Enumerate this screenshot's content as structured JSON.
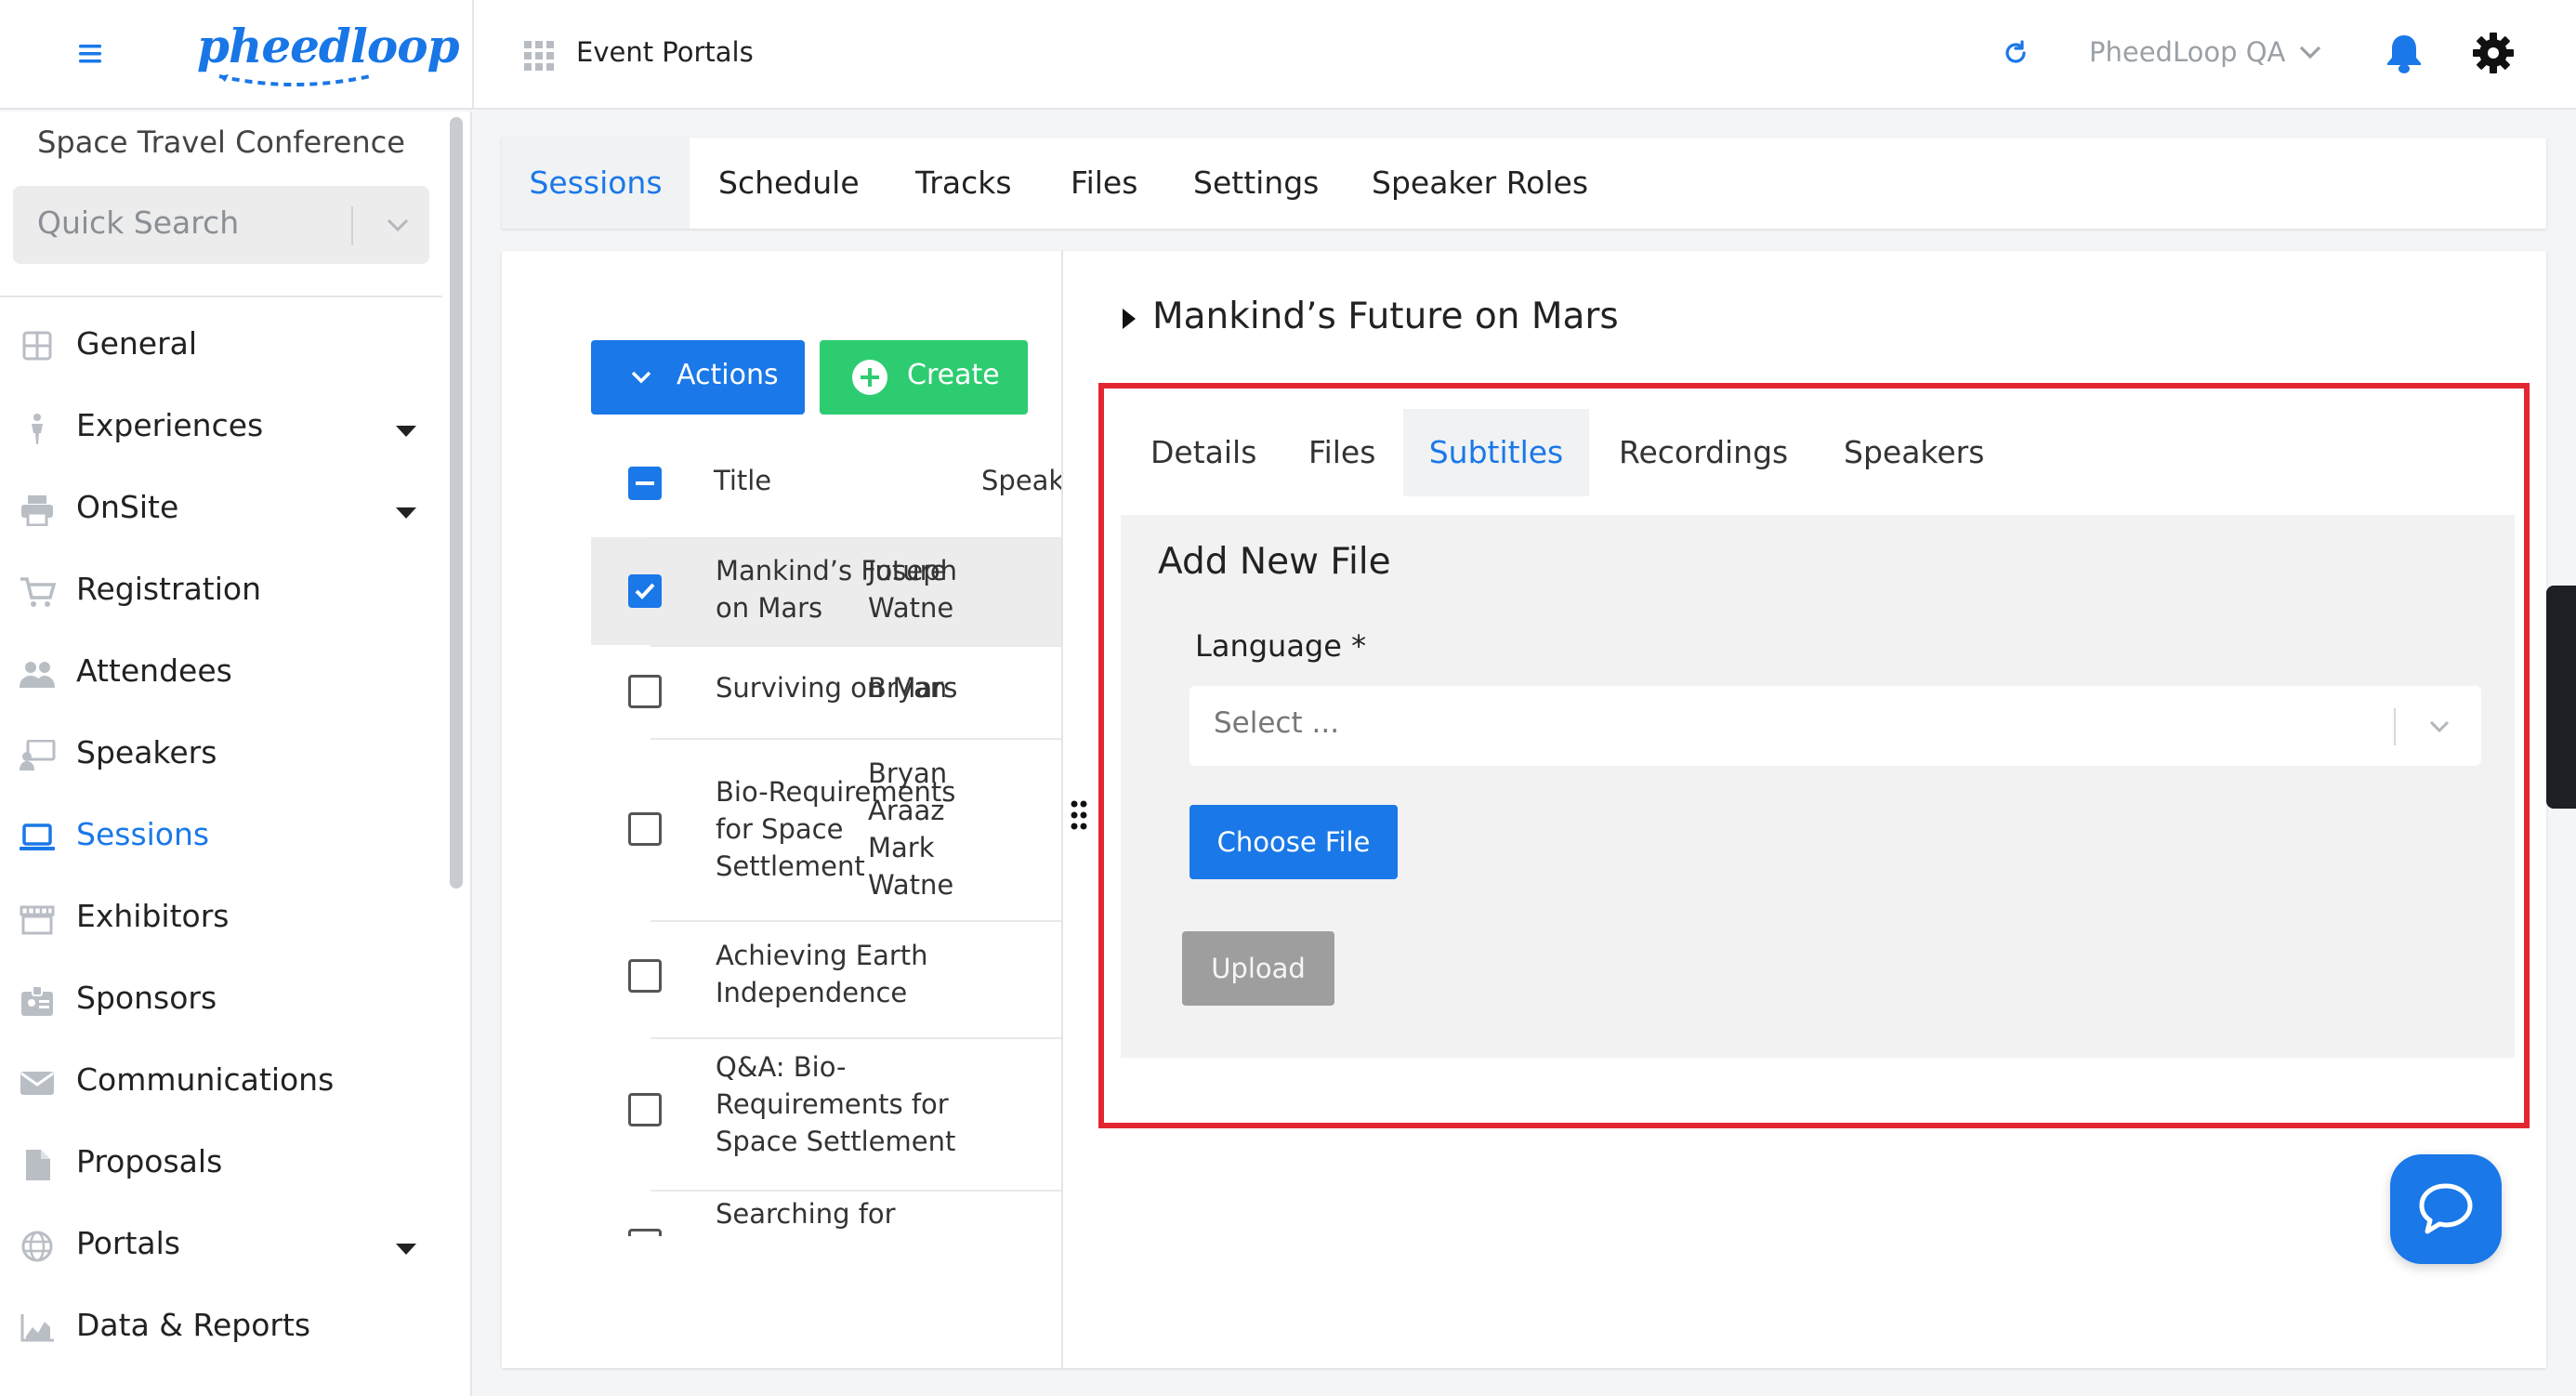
{
  "app": {
    "logo_text": "pheedloop",
    "section_title": "Event Portals",
    "org_selector": "PheedLoop QA",
    "colors": {
      "accent": "#1a78e8",
      "success": "#2ecc71",
      "highlight": "#e32630",
      "disabled": "#9e9e9e"
    }
  },
  "sidebar": {
    "event_name": "Space Travel Conference",
    "search_placeholder": "Quick Search",
    "items": [
      {
        "label": "General",
        "icon": "grid-icon",
        "expandable": false,
        "active": false
      },
      {
        "label": "Experiences",
        "icon": "person-icon",
        "expandable": true,
        "active": false
      },
      {
        "label": "OnSite",
        "icon": "printer-icon",
        "expandable": true,
        "active": false
      },
      {
        "label": "Registration",
        "icon": "cart-icon",
        "expandable": false,
        "active": false
      },
      {
        "label": "Attendees",
        "icon": "people-icon",
        "expandable": false,
        "active": false
      },
      {
        "label": "Speakers",
        "icon": "presenter-icon",
        "expandable": false,
        "active": false
      },
      {
        "label": "Sessions",
        "icon": "laptop-icon",
        "expandable": false,
        "active": true
      },
      {
        "label": "Exhibitors",
        "icon": "storefront-icon",
        "expandable": false,
        "active": false
      },
      {
        "label": "Sponsors",
        "icon": "badge-icon",
        "expandable": false,
        "active": false
      },
      {
        "label": "Communications",
        "icon": "mail-icon",
        "expandable": false,
        "active": false
      },
      {
        "label": "Proposals",
        "icon": "document-icon",
        "expandable": false,
        "active": false
      },
      {
        "label": "Portals",
        "icon": "globe-icon",
        "expandable": true,
        "active": false
      },
      {
        "label": "Data & Reports",
        "icon": "chart-icon",
        "expandable": false,
        "active": false
      }
    ]
  },
  "main_tabs": [
    {
      "label": "Sessions",
      "active": true
    },
    {
      "label": "Schedule",
      "active": false
    },
    {
      "label": "Tracks",
      "active": false
    },
    {
      "label": "Files",
      "active": false
    },
    {
      "label": "Settings",
      "active": false
    },
    {
      "label": "Speaker Roles",
      "active": false
    }
  ],
  "list": {
    "actions_label": "Actions",
    "create_label": "Create",
    "columns": {
      "title": "Title",
      "speakers": "Speak"
    },
    "rows": [
      {
        "title": "Mankind’s Future on Mars",
        "speakers": "Joseph Watne",
        "selected": true
      },
      {
        "title": "Surviving on Mars",
        "speakers": "Bryan",
        "selected": false
      },
      {
        "title": "Bio-Requirements for Space Settlement",
        "speakers": "Bryan Araaz Mark Watne",
        "selected": false
      },
      {
        "title": "Achieving Earth Independence",
        "speakers": "",
        "selected": false
      },
      {
        "title": "Q&A: Bio-Requirements for Space Settlement",
        "speakers": "",
        "selected": false
      },
      {
        "title": "Searching for",
        "speakers": "",
        "selected": false
      }
    ]
  },
  "detail": {
    "session_title": "Mankind’s Future on Mars",
    "tabs": [
      {
        "label": "Details",
        "active": false
      },
      {
        "label": "Files",
        "active": false
      },
      {
        "label": "Subtitles",
        "active": true
      },
      {
        "label": "Recordings",
        "active": false
      },
      {
        "label": "Speakers",
        "active": false
      }
    ],
    "upload": {
      "heading": "Add New File",
      "language_label": "Language *",
      "language_placeholder": "Select ...",
      "choose_file_label": "Choose File",
      "upload_label": "Upload"
    }
  }
}
